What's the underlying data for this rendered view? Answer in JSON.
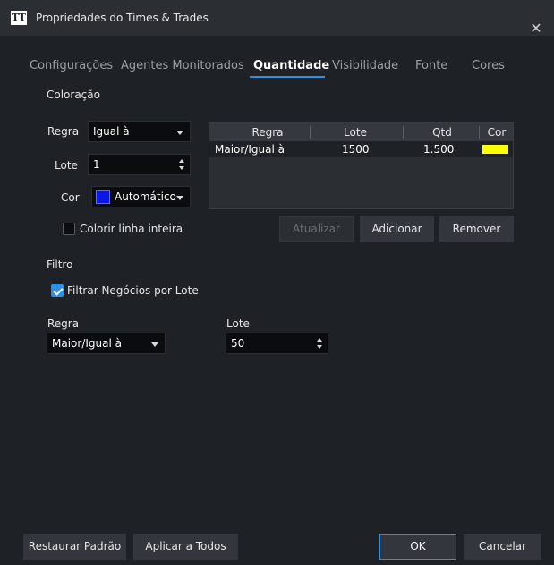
{
  "window": {
    "icon_text": "TT",
    "title": "Propriedades do Times & Trades",
    "close_glyph": "✕"
  },
  "tabs": [
    {
      "label": "Configurações",
      "active": false
    },
    {
      "label": "Agentes Monitorados",
      "active": false
    },
    {
      "label": "Quantidade",
      "active": true
    },
    {
      "label": "Visibilidade",
      "active": false
    },
    {
      "label": "Fonte",
      "active": false
    },
    {
      "label": "Cores",
      "active": false
    }
  ],
  "coloracao": {
    "section_label": "Coloração",
    "regra_label": "Regra",
    "regra_value": "Igual à",
    "lote_label": "Lote",
    "lote_value": "1",
    "cor_label": "Cor",
    "cor_value": "Automático",
    "cor_swatch": "#0a17e6",
    "colorir_label": "Colorir linha inteira",
    "colorir_checked": false
  },
  "rules_table": {
    "columns": [
      "Regra",
      "Lote",
      "Qtd",
      "Cor"
    ],
    "rows": [
      {
        "regra": "Maior/Igual à",
        "lote": "1500",
        "qtd": "1.500",
        "cor": "#ffff00"
      }
    ]
  },
  "table_buttons": {
    "atualizar": "Atualizar",
    "adicionar": "Adicionar",
    "remover": "Remover"
  },
  "filtro": {
    "section_label": "Filtro",
    "filtrar_label": "Filtrar Negócios por Lote",
    "filtrar_checked": true,
    "regra_label": "Regra",
    "regra_value": "Maior/Igual à",
    "lote_label": "Lote",
    "lote_value": "50"
  },
  "footer": {
    "restaurar": "Restaurar Padrão",
    "aplicar": "Aplicar a Todos",
    "ok": "OK",
    "cancelar": "Cancelar"
  },
  "colors": {
    "accent": "#2f8fe5",
    "background": "#1e2125",
    "titlebar": "#2b2e33"
  }
}
